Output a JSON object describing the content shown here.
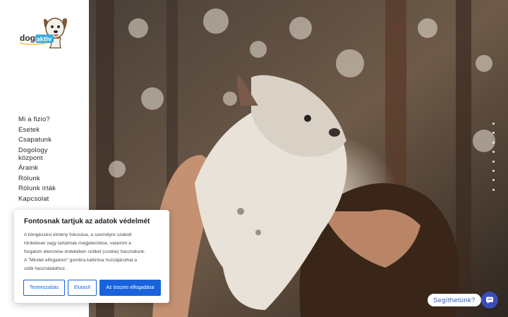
{
  "brand": {
    "logo_text": "dogaktiv"
  },
  "nav": {
    "items": [
      {
        "label": "Mi a fizio?"
      },
      {
        "label": "Esetek"
      },
      {
        "label": "Csapatunk"
      },
      {
        "label": "Dogology"
      },
      {
        "label": "központ"
      },
      {
        "label": "Áraink"
      },
      {
        "label": "Rólunk"
      },
      {
        "label": "Rólunk írták"
      },
      {
        "label": "Kapcsolat"
      }
    ]
  },
  "hero": {
    "image": "man-lifting-french-bulldog-in-forest"
  },
  "slider": {
    "dot_count": 8
  },
  "cookie_banner": {
    "title": "Fontosnak tartjuk az adatok védelmét",
    "lines": [
      "A böngészési élmény fokozása, a személyre szabott",
      "hirdetések vagy tartalmak megjelenítése, valamint a",
      "forgalom elemzése érdekében sütiket (cookie) használunk.",
      "A \"Mindet elfogadom\" gombra kattintva hozzájárulhat a",
      "sütik használatához."
    ],
    "customize_label": "Testreszabás",
    "reject_label": "Elutasít",
    "accept_label": "Az összes elfogadása",
    "accent_color": "#1863dc"
  },
  "chat": {
    "help_label": "Segíthetünk?",
    "icon": "chat-bubble-icon",
    "color": "#3a4db8"
  }
}
